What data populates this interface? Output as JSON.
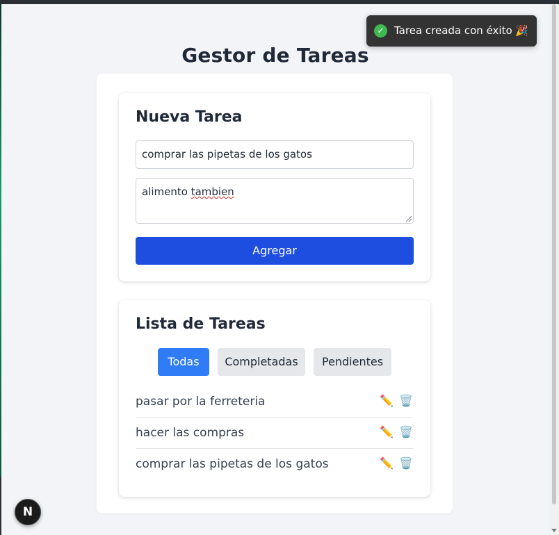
{
  "page": {
    "title": "Gestor de Tareas"
  },
  "form": {
    "heading": "Nueva Tarea",
    "title_value": "comprar las pipetas de los gatos",
    "description_prefix": "alimento ",
    "description_misspelled_word": "tambien",
    "add_label": "Agregar"
  },
  "list": {
    "heading": "Lista de Tareas",
    "filters": [
      {
        "label": "Todas",
        "active": true
      },
      {
        "label": "Completadas",
        "active": false
      },
      {
        "label": "Pendientes",
        "active": false
      }
    ],
    "tasks": [
      {
        "title": "pasar por la ferreteria"
      },
      {
        "title": "hacer las compras"
      },
      {
        "title": "comprar las pipetas de los gatos"
      }
    ],
    "edit_icon": "✏️",
    "delete_icon": "🗑️"
  },
  "toast": {
    "message": "Tarea creada con éxito 🎉",
    "icon": "check-circle-icon",
    "check_glyph": "✓"
  },
  "dev_badge": {
    "label": "N"
  },
  "colors": {
    "primary_button": "#1d4ee0",
    "active_filter": "#2f7cf6",
    "toast_bg": "#333333",
    "success": "#3fb950"
  }
}
